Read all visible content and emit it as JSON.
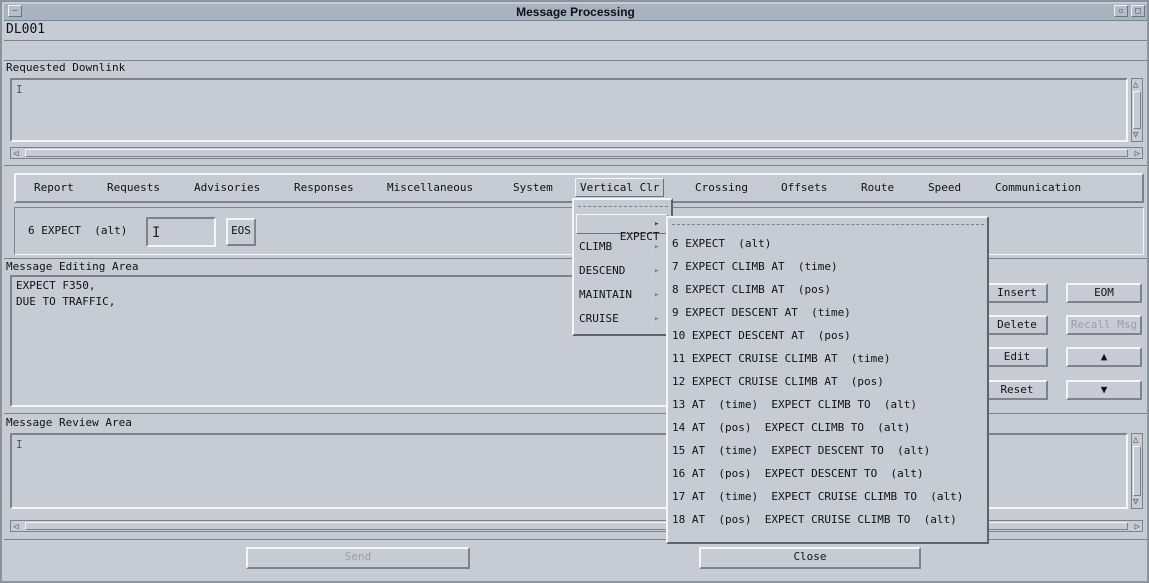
{
  "window": {
    "title": "Message Processing"
  },
  "msg_id": "DL001",
  "requested_downlink": {
    "label": "Requested Downlink",
    "value": ""
  },
  "menubar": {
    "items": [
      "Report",
      "Requests",
      "Advisories",
      "Responses",
      "Miscellaneous",
      "System",
      "Vertical Clr",
      "Crossing",
      "Offsets",
      "Route",
      "Speed",
      "Communication"
    ],
    "active": "Vertical Clr"
  },
  "element_row": {
    "label": "6 EXPECT  (alt)",
    "value": "",
    "eos_label": "EOS"
  },
  "editing": {
    "label": "Message Editing Area",
    "lines": [
      "EXPECT F350,",
      "DUE TO TRAFFIC,"
    ]
  },
  "side_buttons": {
    "insert": "Insert",
    "eom": "EOM",
    "delete": "Delete",
    "recall": "Recall Msg",
    "edit": "Edit",
    "up": "▲",
    "reset": "Reset",
    "down": "▼"
  },
  "review": {
    "label": "Message Review Area",
    "value": ""
  },
  "bottom": {
    "send": "Send",
    "close": "Close"
  },
  "vertical_menu": {
    "items": [
      "EXPECT",
      "CLIMB",
      "DESCEND",
      "MAINTAIN",
      "CRUISE"
    ],
    "selected": "EXPECT"
  },
  "expect_submenu": {
    "items": [
      "6 EXPECT  (alt)",
      "7 EXPECT CLIMB AT  (time)",
      "8 EXPECT CLIMB AT  (pos)",
      "9 EXPECT DESCENT AT  (time)",
      "10 EXPECT DESCENT AT  (pos)",
      "11 EXPECT CRUISE CLIMB AT  (time)",
      "12 EXPECT CRUISE CLIMB AT  (pos)",
      "13 AT  (time)  EXPECT CLIMB TO  (alt)",
      "14 AT  (pos)  EXPECT CLIMB TO  (alt)",
      "15 AT  (time)  EXPECT DESCENT TO  (alt)",
      "16 AT  (pos)  EXPECT DESCENT TO  (alt)",
      "17 AT  (time)  EXPECT CRUISE CLIMB TO  (alt)",
      "18 AT  (pos)  EXPECT CRUISE CLIMB TO  (alt)"
    ]
  },
  "icons": {
    "caret": "text-caret-icon",
    "submenu": "submenu-arrow-icon"
  }
}
